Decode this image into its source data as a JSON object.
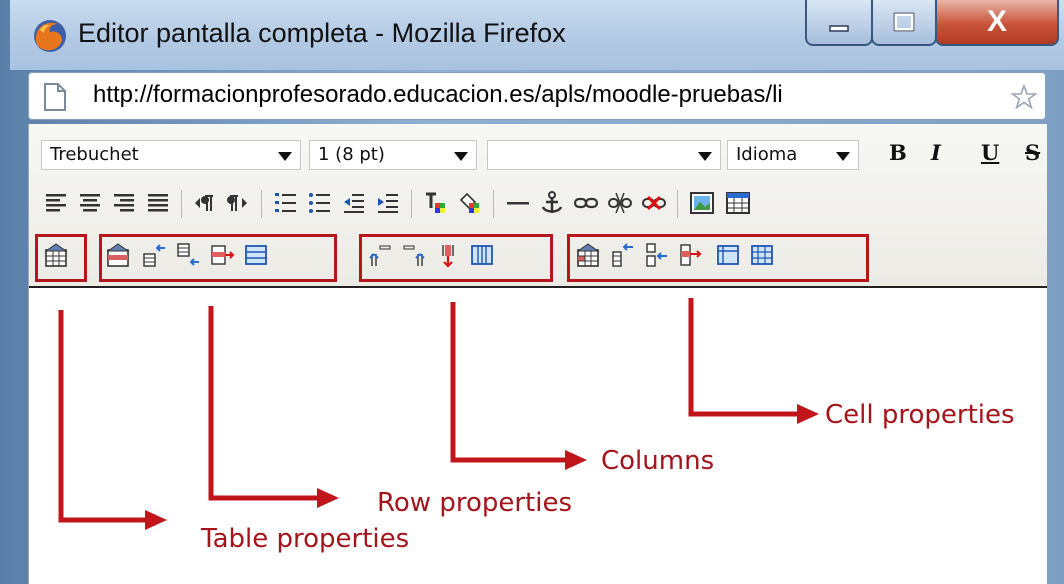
{
  "window": {
    "title": "Editor pantalla completa - Mozilla Firefox",
    "close_label": "X"
  },
  "address_bar": {
    "url": "http://formacionprofesorado.educacion.es/apls/moodle-pruebas/li"
  },
  "toolbar": {
    "font_family": "Trebuchet",
    "font_size": "1 (8 pt)",
    "format_block": "",
    "language": "Idioma",
    "bold_label": "B",
    "italic_label": "I",
    "underline_label": "U",
    "strike_label": "S"
  },
  "annotations": {
    "table_properties": "Table properties",
    "row_properties": "Row properties",
    "columns": "Columns",
    "cell_properties": "Cell properties"
  },
  "colors": {
    "highlight": "#b5161b",
    "arrow": "#c0161b",
    "annotation_text": "#a3151b"
  }
}
